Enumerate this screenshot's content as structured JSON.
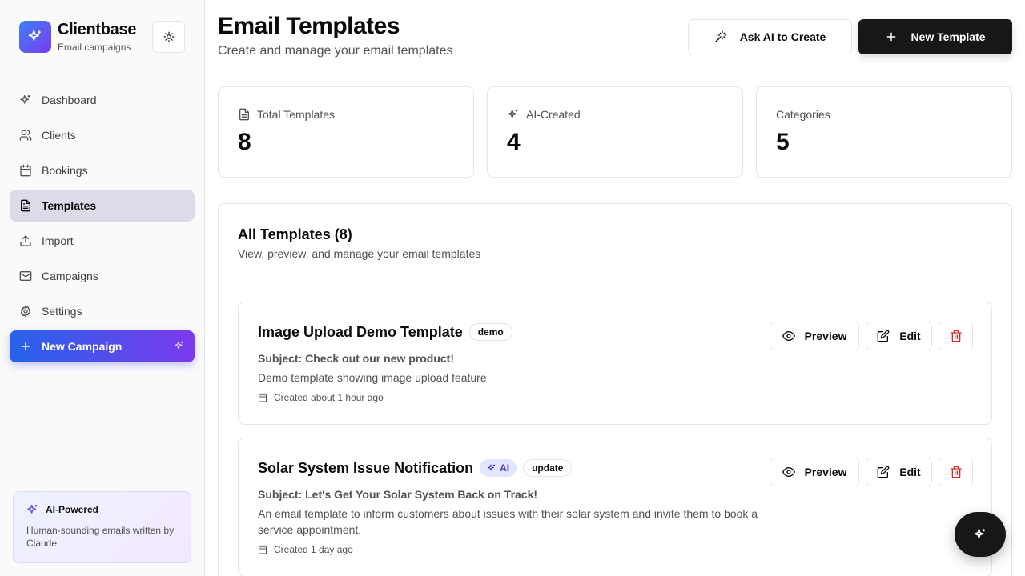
{
  "brand": {
    "name": "Clientbase",
    "subtitle": "Email campaigns"
  },
  "nav": {
    "items": [
      {
        "label": "Dashboard",
        "icon": "sparkle-icon"
      },
      {
        "label": "Clients",
        "icon": "users-icon"
      },
      {
        "label": "Bookings",
        "icon": "calendar-icon"
      },
      {
        "label": "Templates",
        "icon": "file-text-icon",
        "active": true
      },
      {
        "label": "Import",
        "icon": "upload-icon"
      },
      {
        "label": "Campaigns",
        "icon": "mail-icon"
      },
      {
        "label": "Settings",
        "icon": "gear-icon"
      }
    ],
    "new_campaign": "New Campaign"
  },
  "ai_card": {
    "title": "AI-Powered",
    "description": "Human-sounding emails written by Claude"
  },
  "header": {
    "title": "Email Templates",
    "subtitle": "Create and manage your email templates",
    "ask_ai": "Ask AI to Create",
    "new_template": "New Template"
  },
  "stats": [
    {
      "label": "Total Templates",
      "value": "8",
      "icon": "file-text-icon"
    },
    {
      "label": "AI-Created",
      "value": "4",
      "icon": "sparkle-icon"
    },
    {
      "label": "Categories",
      "value": "5"
    }
  ],
  "panel": {
    "title": "All Templates (8)",
    "subtitle": "View, preview, and manage your email templates"
  },
  "templates": [
    {
      "name": "Image Upload Demo Template",
      "ai": false,
      "tag": "demo",
      "subject": "Subject: Check out our new product!",
      "description": "Demo template showing image upload feature",
      "created": "Created about 1 hour ago"
    },
    {
      "name": "Solar System Issue Notification",
      "ai": true,
      "ai_label": "AI",
      "tag": "update",
      "subject": "Subject: Let's Get Your Solar System Back on Track!",
      "description": "An email template to inform customers about issues with their solar system and invite them to book a service appointment.",
      "created": "Created 1 day ago"
    }
  ],
  "actions": {
    "preview": "Preview",
    "edit": "Edit"
  },
  "colors": {
    "accent_start": "#2563eb",
    "accent_end": "#7c3aed",
    "primary_button": "#171717",
    "delete": "#dc2626",
    "active_nav": "#dcdbe8"
  }
}
